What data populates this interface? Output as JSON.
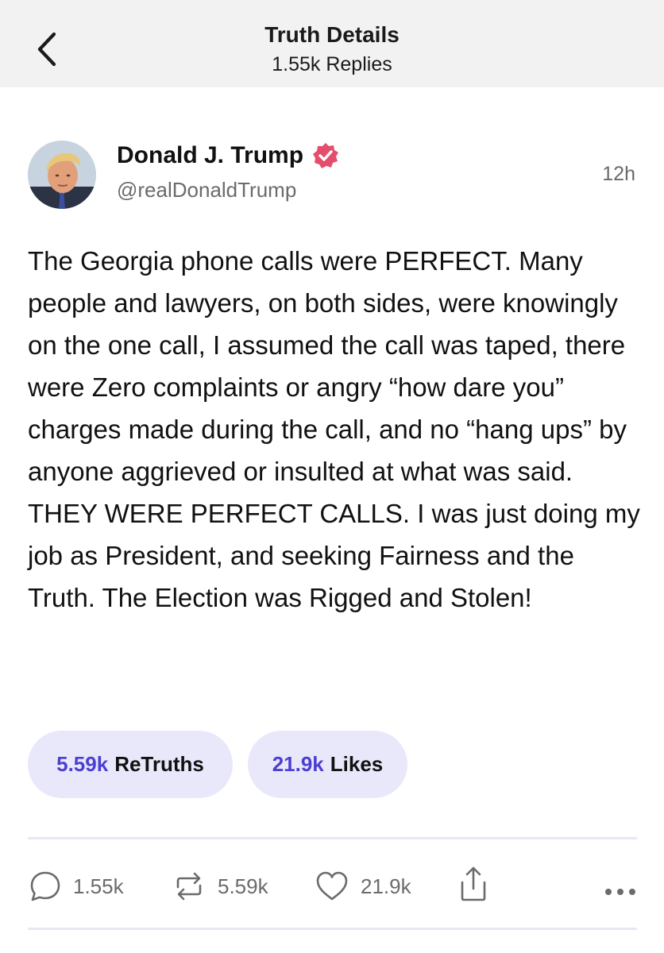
{
  "header": {
    "title": "Truth Details",
    "subtitle": "1.55k Replies"
  },
  "post": {
    "author_name": "Donald J. Trump",
    "handle": "@realDonaldTrump",
    "time": "12h",
    "text": "The Georgia phone calls were PERFECT. Many people and lawyers, on both sides, were knowingly on the one call, I assumed the call was taped, there were Zero complaints or angry “how dare you” charges made during the call, and no “hang ups” by anyone aggrieved or insulted at what was said. THEY WERE PERFECT CALLS. I was just doing my job as President, and seeking Fairness and the Truth. The Election was Rigged and Stolen!"
  },
  "stats": {
    "retruths_count": "5.59k",
    "retruths_label": "ReTruths",
    "likes_count": "21.9k",
    "likes_label": "Likes"
  },
  "actions": {
    "replies": "1.55k",
    "retruths": "5.59k",
    "likes": "21.9k"
  },
  "icons": {
    "back": "chevron-left-icon",
    "verified": "verified-badge-icon",
    "reply": "speech-bubble-icon",
    "retruth": "repost-arrows-icon",
    "like": "heart-icon",
    "share": "share-icon",
    "more": "ellipsis-icon"
  },
  "colors": {
    "accent": "#4b3fd1",
    "pill_background": "#e9e8fb",
    "verified_badge": "#e44d6b",
    "header_background": "#f2f2f2",
    "muted_text": "#6b6b6b"
  }
}
